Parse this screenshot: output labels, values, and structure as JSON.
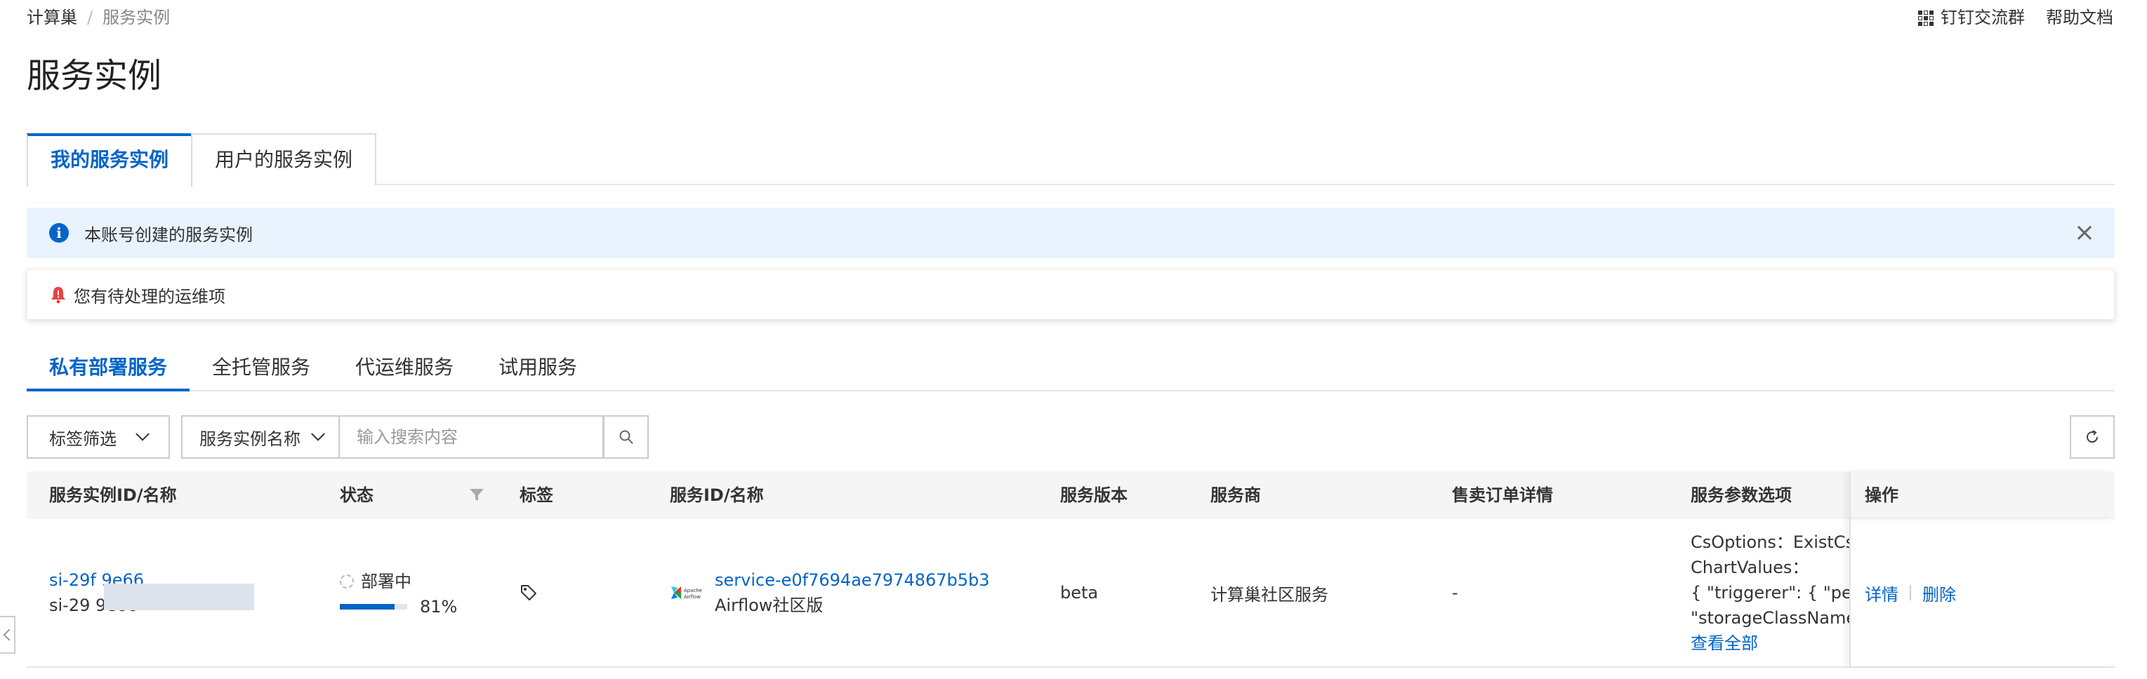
{
  "breadcrumb": {
    "root": "计算巢",
    "separator": "/",
    "current": "服务实例"
  },
  "top_links": {
    "dingtalk": "钉钉交流群",
    "help": "帮助文档"
  },
  "page_title": "服务实例",
  "main_tabs": [
    {
      "label": "我的服务实例",
      "active": true
    },
    {
      "label": "用户的服务实例",
      "active": false
    }
  ],
  "info_bar": {
    "text": "本账号创建的服务实例"
  },
  "alert": {
    "text": "您有待处理的运维项"
  },
  "sub_tabs": [
    {
      "label": "私有部署服务",
      "active": true
    },
    {
      "label": "全托管服务",
      "active": false
    },
    {
      "label": "代运维服务",
      "active": false
    },
    {
      "label": "试用服务",
      "active": false
    }
  ],
  "filters": {
    "tag_filter": "标签筛选",
    "name_filter": "服务实例名称",
    "search_placeholder": "输入搜索内容"
  },
  "table": {
    "columns": [
      "服务实例ID/名称",
      "状态",
      "标签",
      "服务ID/名称",
      "服务版本",
      "服务商",
      "售卖订单详情",
      "服务参数选项",
      "操作"
    ],
    "rows": [
      {
        "instance_id": "si-29f          9e66",
        "instance_name": "si-29          9e66",
        "status": "部署中",
        "progress_percent": 81,
        "progress_label": "81%",
        "service_id": "service-e0f7694ae7974867b5b3",
        "service_name": "Airflow社区版",
        "version": "beta",
        "vendor": "计算巢社区服务",
        "order": "-",
        "params": [
          "CsOptions：ExistCs",
          "ChartValues：",
          "{ \"triggerer\": { \"persist",
          "\"storageClassName\": \""
        ],
        "view_all": "查看全部",
        "ops": {
          "detail": "详情",
          "delete": "删除"
        }
      }
    ]
  },
  "colors": {
    "accent": "#0064c8",
    "info_bg": "#e8f3fd",
    "alert_bell": "#e8423f"
  }
}
